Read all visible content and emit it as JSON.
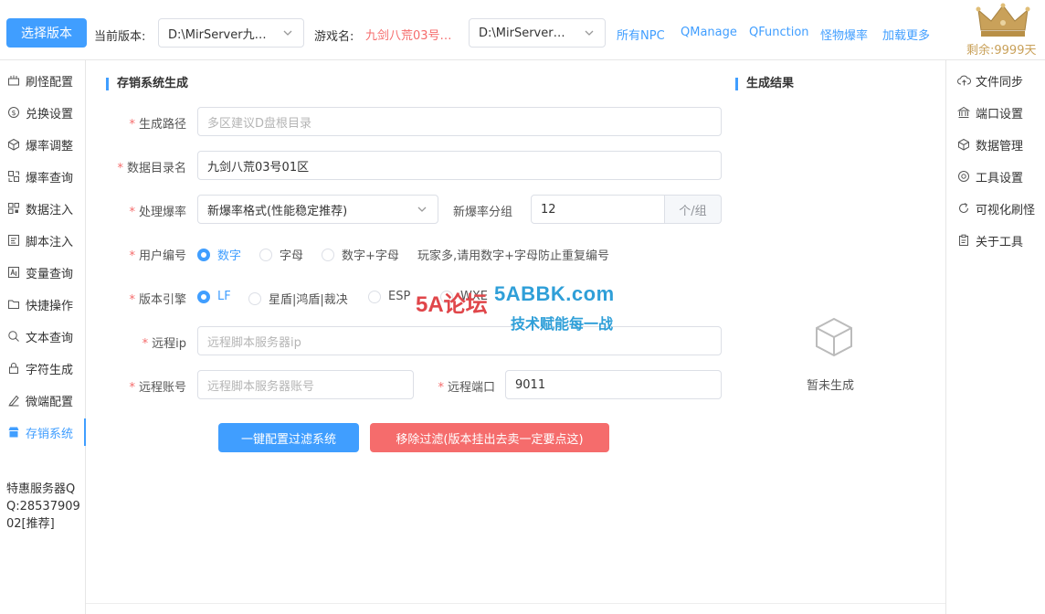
{
  "header": {
    "select_version_button": "选择版本",
    "current_version_label": "当前版本:",
    "current_version_value": "D:\\MirServer九…",
    "game_name_label": "游戏名:",
    "game_name_value": "九剑八荒03号…",
    "game_path_value": "D:\\MirServer…",
    "links": [
      "所有NPC",
      "QManage",
      "QFunction",
      "怪物爆率",
      "加载更多"
    ],
    "remaining": "剩余:9999天"
  },
  "sidebar": {
    "items": [
      {
        "label": "刷怪配置",
        "icon": "monster-refresh-icon"
      },
      {
        "label": "兑换设置",
        "icon": "exchange-icon"
      },
      {
        "label": "爆率调整",
        "icon": "cube-icon"
      },
      {
        "label": "爆率查询",
        "icon": "query-icon"
      },
      {
        "label": "数据注入",
        "icon": "qrcode-icon"
      },
      {
        "label": "脚本注入",
        "icon": "script-icon"
      },
      {
        "label": "变量查询",
        "icon": "variable-icon"
      },
      {
        "label": "快捷操作",
        "icon": "folder-icon"
      },
      {
        "label": "文本查询",
        "icon": "search-icon"
      },
      {
        "label": "字符生成",
        "icon": "lock-icon"
      },
      {
        "label": "微端配置",
        "icon": "pen-icon"
      },
      {
        "label": "存销系统",
        "icon": "shop-icon"
      }
    ],
    "active_index": 11,
    "promo": "特惠服务器QQ:2853790902[推荐]"
  },
  "right_sidebar": {
    "items": [
      {
        "label": "文件同步",
        "icon": "cloud-sync-icon"
      },
      {
        "label": "端口设置",
        "icon": "bank-icon"
      },
      {
        "label": "数据管理",
        "icon": "box-icon"
      },
      {
        "label": "工具设置",
        "icon": "gear-icon"
      },
      {
        "label": "可视化刷怪",
        "icon": "refresh-icon"
      },
      {
        "label": "关于工具",
        "icon": "clipboard-icon"
      }
    ]
  },
  "form": {
    "title": "存销系统生成",
    "path_label": "生成路径",
    "path_placeholder": "多区建议D盘根目录",
    "data_dir_label": "数据目录名",
    "data_dir_value": "九剑八荒03号01区",
    "rate_label": "处理爆率",
    "rate_value": "新爆率格式(性能稳定推荐)",
    "group_label": "新爆率分组",
    "group_value": "12",
    "group_suffix": "个/组",
    "user_no_label": "用户编号",
    "user_no_options": [
      "数字",
      "字母",
      "数字+字母"
    ],
    "user_no_selected": 0,
    "user_no_hint": "玩家多,请用数字+字母防止重复编号",
    "engine_label": "版本引擎",
    "engine_options": [
      "LF",
      "星盾|鸿盾|裁决",
      "ESP",
      "WXE"
    ],
    "engine_selected": 0,
    "remote_ip_label": "远程ip",
    "remote_ip_placeholder": "远程脚本服务器ip",
    "remote_account_label": "远程账号",
    "remote_account_placeholder": "远程脚本服务器账号",
    "remote_port_label": "远程端口",
    "remote_port_value": "9011",
    "config_button": "一键配置过滤系统",
    "remove_button": "移除过滤(版本挂出去卖一定要点这)"
  },
  "result": {
    "title": "生成结果",
    "empty_text": "暂未生成"
  },
  "watermark": {
    "logo": "5A论坛",
    "site": "5ABBK.com",
    "slogan": "技术赋能每一战"
  },
  "colors": {
    "primary": "#409eff",
    "danger": "#f56c6c",
    "gold": "#c9a15a"
  }
}
